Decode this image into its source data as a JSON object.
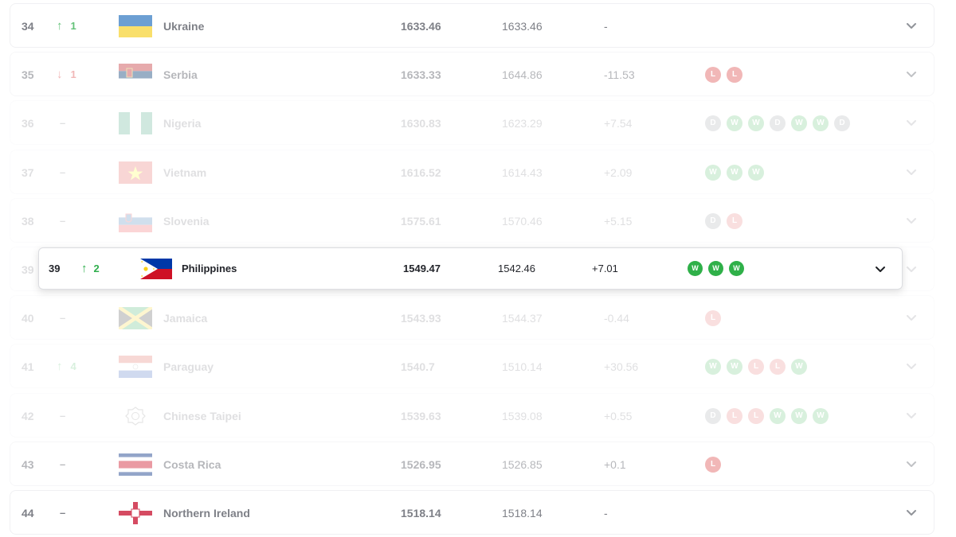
{
  "rows": [
    {
      "rank": "34",
      "move_dir": "up",
      "move": "1",
      "country": "Ukraine",
      "flag": "ukraine",
      "points": "1633.46",
      "prev": "1633.46",
      "diff": "-",
      "results": [],
      "fade": "strong"
    },
    {
      "rank": "35",
      "move_dir": "down",
      "move": "1",
      "country": "Serbia",
      "flag": "serbia",
      "points": "1633.33",
      "prev": "1644.86",
      "diff": "-11.53",
      "results": [
        "L",
        "L"
      ],
      "fade": "mid"
    },
    {
      "rank": "36",
      "move_dir": "none",
      "move": "",
      "country": "Nigeria",
      "flag": "nigeria",
      "points": "1630.83",
      "prev": "1623.29",
      "diff": "+7.54",
      "results": [
        "D",
        "W",
        "W",
        "D",
        "W",
        "W",
        "D"
      ],
      "fade": "low"
    },
    {
      "rank": "37",
      "move_dir": "none",
      "move": "",
      "country": "Vietnam",
      "flag": "vietnam",
      "points": "1616.52",
      "prev": "1614.43",
      "diff": "+2.09",
      "results": [
        "W",
        "W",
        "W"
      ],
      "fade": "low"
    },
    {
      "rank": "38",
      "move_dir": "none",
      "move": "",
      "country": "Slovenia",
      "flag": "slovenia",
      "points": "1575.61",
      "prev": "1570.46",
      "diff": "+5.15",
      "results": [
        "D",
        "L"
      ],
      "fade": "low"
    },
    {
      "rank": "39",
      "move_dir": "none",
      "move": "",
      "country": "",
      "flag": "",
      "points": "",
      "prev": "",
      "diff": "",
      "results": [],
      "fade": "low"
    },
    {
      "rank": "40",
      "move_dir": "none",
      "move": "",
      "country": "Jamaica",
      "flag": "jamaica",
      "points": "1543.93",
      "prev": "1544.37",
      "diff": "-0.44",
      "results": [
        "L"
      ],
      "fade": "low"
    },
    {
      "rank": "41",
      "move_dir": "up",
      "move": "4",
      "country": "Paraguay",
      "flag": "paraguay",
      "points": "1540.7",
      "prev": "1510.14",
      "diff": "+30.56",
      "results": [
        "W",
        "W",
        "L",
        "L",
        "W"
      ],
      "fade": "low"
    },
    {
      "rank": "42",
      "move_dir": "none",
      "move": "",
      "country": "Chinese Taipei",
      "flag": "taipei",
      "points": "1539.63",
      "prev": "1539.08",
      "diff": "+0.55",
      "results": [
        "D",
        "L",
        "L",
        "W",
        "W",
        "W"
      ],
      "fade": "low"
    },
    {
      "rank": "43",
      "move_dir": "none",
      "move": "",
      "country": "Costa Rica",
      "flag": "costarica",
      "points": "1526.95",
      "prev": "1526.85",
      "diff": "+0.1",
      "results": [
        "L"
      ],
      "fade": "mid"
    },
    {
      "rank": "44",
      "move_dir": "none",
      "move": "",
      "country": "Northern Ireland",
      "flag": "nireland",
      "points": "1518.14",
      "prev": "1518.14",
      "diff": "-",
      "results": [],
      "fade": "strong"
    }
  ],
  "highlight": {
    "rank": "39",
    "move_dir": "up",
    "move": "2",
    "country": "Philippines",
    "flag": "philippines",
    "points": "1549.47",
    "prev": "1542.46",
    "diff": "+7.01",
    "results": [
      "W",
      "W",
      "W"
    ]
  },
  "icons": {
    "up": "arrow-up-icon",
    "down": "arrow-down-icon",
    "expand": "chevron-down-icon"
  },
  "colors": {
    "win": "#2fb049",
    "loss": "#e05656",
    "draw": "#8b8d94",
    "up": "#2fae4c",
    "down": "#e05656"
  }
}
